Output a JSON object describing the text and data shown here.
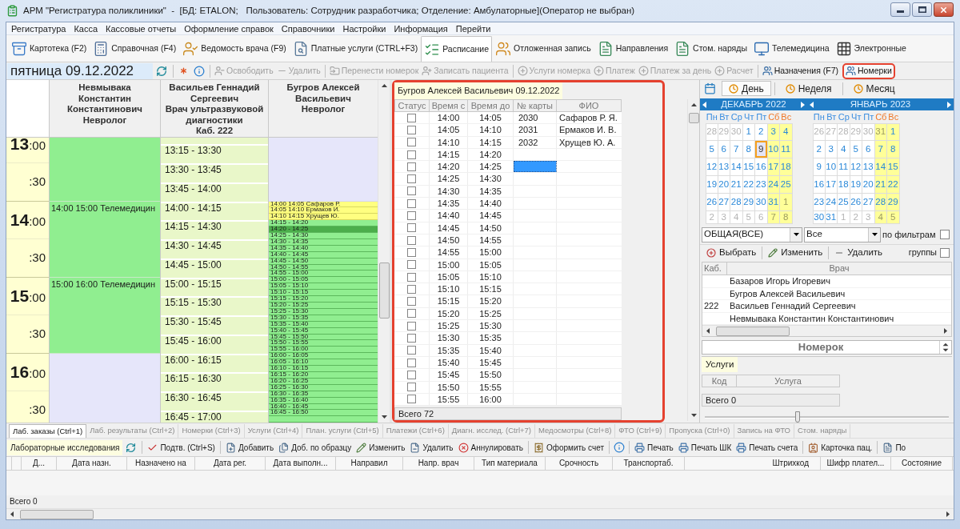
{
  "window": {
    "title": "АРМ \"Регистратура поликлиники\"  -  [БД: ETALON;   Пользователь: Сотрудник разработчика; Отделение: Амбулаторные](Оператор не выбран)"
  },
  "menu": [
    "Регистратура",
    "Касса",
    "Кассовые отчеты",
    "Оформление справок",
    "Справочники",
    "Настройки",
    "Информация",
    "Перейти"
  ],
  "main_toolbar": [
    {
      "label": "Картотека (F2)",
      "selected": false
    },
    {
      "label": "Справочная (F4)",
      "selected": false
    },
    {
      "label": "Ведомость врача (F9)",
      "selected": false
    },
    {
      "label": "Платные услуги (CTRL+F3)",
      "selected": false
    },
    {
      "label": "Расписание",
      "selected": true
    },
    {
      "label": "Отложенная запись",
      "selected": false
    },
    {
      "label": "Направления",
      "selected": false
    },
    {
      "label": "Стом. наряды",
      "selected": false
    },
    {
      "label": "Телемедицина",
      "selected": false
    },
    {
      "label": "Электронные",
      "selected": false
    }
  ],
  "schedule_toolbar": {
    "date": "пятница 09.12.2022",
    "buttons": [
      {
        "label": "Освободить",
        "disabled": true,
        "highlighted": false
      },
      {
        "label": "Удалить",
        "disabled": true,
        "highlighted": false
      },
      {
        "label": "Перенести номерок",
        "disabled": true,
        "highlighted": false
      },
      {
        "label": "Записать пациента",
        "disabled": true,
        "highlighted": false
      },
      {
        "label": "Услуги номерка",
        "disabled": true,
        "highlighted": false
      },
      {
        "label": "Платеж",
        "disabled": true,
        "highlighted": false
      },
      {
        "label": "Платеж за день",
        "disabled": true,
        "highlighted": false
      },
      {
        "label": "Расчет",
        "disabled": true,
        "highlighted": false
      },
      {
        "label": "Назначения (F7)",
        "disabled": false,
        "highlighted": false
      },
      {
        "label": "Номерки",
        "disabled": false,
        "highlighted": true
      }
    ]
  },
  "schedule": {
    "times": [
      {
        "hour": "13",
        "minutes": ":00"
      },
      {
        "minutes": ":30"
      },
      {
        "hour": "14",
        "minutes": ":00"
      },
      {
        "minutes": ":30"
      },
      {
        "hour": "15",
        "minutes": ":00"
      },
      {
        "minutes": ":30"
      },
      {
        "hour": "16",
        "minutes": ":00"
      },
      {
        "minutes": ":30"
      }
    ],
    "doctors": [
      {
        "name": "Невмывака Константин Константинович",
        "role": "Невролог",
        "slots": [
          {
            "kind": "reserved"
          },
          {
            "kind": "reserved",
            "label": "14:00 15:00 Телемедицин"
          },
          {
            "kind": "reserved",
            "label": "15:00 16:00 Телемедицин"
          },
          {
            "kind": "free"
          }
        ]
      },
      {
        "name": "Васильев Геннадий Сергеевич",
        "role": "Врач ультразвуковой диагностики",
        "room": "Каб. 222",
        "slots": [
          {
            "kind": "interval"
          },
          {
            "kind": "interval",
            "label": "13:15 - 13:30"
          },
          {
            "kind": "interval",
            "label": "13:30 - 13:45"
          },
          {
            "kind": "interval",
            "label": "13:45 - 14:00"
          },
          {
            "kind": "interval",
            "label": "14:00 - 14:15"
          },
          {
            "kind": "interval",
            "label": "14:15 - 14:30"
          },
          {
            "kind": "interval",
            "label": "14:30 - 14:45"
          },
          {
            "kind": "interval",
            "label": "14:45 - 15:00"
          },
          {
            "kind": "interval",
            "label": "15:00 - 15:15"
          },
          {
            "kind": "interval",
            "label": "15:15 - 15:30"
          },
          {
            "kind": "interval",
            "label": "15:30 - 15:45"
          },
          {
            "kind": "interval",
            "label": "15:45 - 16:00"
          },
          {
            "kind": "interval",
            "label": "16:00 - 16:15"
          },
          {
            "kind": "interval",
            "label": "16:15 - 16:30"
          },
          {
            "kind": "interval",
            "label": "16:30 - 16:45"
          },
          {
            "kind": "interval",
            "label": "16:45 - 17:00"
          }
        ]
      },
      {
        "name": "Бугров Алексей Васильевич",
        "role": "Невролог",
        "slots": [
          {
            "kind": "free",
            "selected": false
          },
          {
            "kind": "booked",
            "label": "14:00 14:05 Сафаров Р.",
            "selected": false
          },
          {
            "kind": "booked",
            "label": "14:05 14:10 Ермаков И.",
            "selected": false
          },
          {
            "kind": "booked",
            "label": "14:10 14:15 Хрущев Ю.",
            "selected": false
          },
          {
            "kind": "open",
            "label": "14:15 - 14:20",
            "selected": false
          },
          {
            "kind": "open",
            "label": "14:20 - 14:25",
            "selected": true
          },
          {
            "kind": "open",
            "label": "14:25 - 14:30",
            "selected": false
          },
          {
            "kind": "open",
            "label": "14:30 - 14:35",
            "selected": false
          },
          {
            "kind": "open",
            "label": "14:35 - 14:40",
            "selected": false
          },
          {
            "kind": "open",
            "label": "14:40 - 14:45",
            "selected": false
          },
          {
            "kind": "open",
            "label": "14:45 - 14:50",
            "selected": false
          },
          {
            "kind": "open",
            "label": "14:50 - 14:55",
            "selected": false
          },
          {
            "kind": "open",
            "label": "14:55 - 15:00",
            "selected": false
          },
          {
            "kind": "open",
            "label": "15:00 - 15:05",
            "selected": false
          },
          {
            "kind": "open",
            "label": "15:05 - 15:10",
            "selected": false
          },
          {
            "kind": "open",
            "label": "15:10 - 15:15",
            "selected": false
          },
          {
            "kind": "open",
            "label": "15:15 - 15:20",
            "selected": false
          },
          {
            "kind": "open",
            "label": "15:20 - 15:25",
            "selected": false
          },
          {
            "kind": "open",
            "label": "15:25 - 15:30",
            "selected": false
          },
          {
            "kind": "open",
            "label": "15:30 - 15:35",
            "selected": false
          },
          {
            "kind": "open",
            "label": "15:35 - 15:40",
            "selected": false
          },
          {
            "kind": "open",
            "label": "15:40 - 15:45",
            "selected": false
          },
          {
            "kind": "open",
            "label": "15:45 - 15:50",
            "selected": false
          },
          {
            "kind": "open",
            "label": "15:50 - 15:55",
            "selected": false
          },
          {
            "kind": "open",
            "label": "15:55 - 16:00",
            "selected": false
          },
          {
            "kind": "open",
            "label": "16:00 - 16:05",
            "selected": false
          },
          {
            "kind": "open",
            "label": "16:05 - 16:10",
            "selected": false
          },
          {
            "kind": "open",
            "label": "16:10 - 16:15",
            "selected": false
          },
          {
            "kind": "open",
            "label": "16:15 - 16:20",
            "selected": false
          },
          {
            "kind": "open",
            "label": "16:20 - 16:25",
            "selected": false
          },
          {
            "kind": "open",
            "label": "16:25 - 16:30",
            "selected": false
          },
          {
            "kind": "open",
            "label": "16:30 - 16:35",
            "selected": false
          },
          {
            "kind": "open",
            "label": "16:35 - 16:40",
            "selected": false
          },
          {
            "kind": "open",
            "label": "16:40 - 16:45",
            "selected": false
          },
          {
            "kind": "open",
            "label": "16:45 - 16:50",
            "selected": false
          },
          {
            "kind": "open",
            "selected": false
          }
        ]
      }
    ]
  },
  "appointments": {
    "title": "Бугров Алексей Васильевич 09.12.2022",
    "highlighted": true,
    "columns": [
      "Статус",
      "Время с",
      "Время до",
      "№ карты",
      "ФИО"
    ],
    "rows": [
      {
        "checked": false,
        "from": "14:00",
        "to": "14:05",
        "card": "2030",
        "patient": "Сафаров Р. Я.",
        "selected": false
      },
      {
        "checked": false,
        "from": "14:05",
        "to": "14:10",
        "card": "2031",
        "patient": "Ермаков И. В.",
        "selected": false
      },
      {
        "checked": false,
        "from": "14:10",
        "to": "14:15",
        "card": "2032",
        "patient": "Хрущев Ю. А.",
        "selected": false
      },
      {
        "checked": false,
        "from": "14:15",
        "to": "14:20",
        "selected": false
      },
      {
        "checked": false,
        "from": "14:20",
        "to": "14:25",
        "selected": true
      },
      {
        "checked": false,
        "from": "14:25",
        "to": "14:30",
        "selected": false
      },
      {
        "checked": false,
        "from": "14:30",
        "to": "14:35",
        "selected": false
      },
      {
        "checked": false,
        "from": "14:35",
        "to": "14:40",
        "selected": false
      },
      {
        "checked": false,
        "from": "14:40",
        "to": "14:45",
        "selected": false
      },
      {
        "checked": false,
        "from": "14:45",
        "to": "14:50",
        "selected": false
      },
      {
        "checked": false,
        "from": "14:50",
        "to": "14:55",
        "selected": false
      },
      {
        "checked": false,
        "from": "14:55",
        "to": "15:00",
        "selected": false
      },
      {
        "checked": false,
        "from": "15:00",
        "to": "15:05",
        "selected": false
      },
      {
        "checked": false,
        "from": "15:05",
        "to": "15:10",
        "selected": false
      },
      {
        "checked": false,
        "from": "15:10",
        "to": "15:15",
        "selected": false
      },
      {
        "checked": false,
        "from": "15:15",
        "to": "15:20",
        "selected": false
      },
      {
        "checked": false,
        "from": "15:20",
        "to": "15:25",
        "selected": false
      },
      {
        "checked": false,
        "from": "15:25",
        "to": "15:30",
        "selected": false
      },
      {
        "checked": false,
        "from": "15:30",
        "to": "15:35",
        "selected": false
      },
      {
        "checked": false,
        "from": "15:35",
        "to": "15:40",
        "selected": false
      },
      {
        "checked": false,
        "from": "15:40",
        "to": "15:45",
        "selected": false
      },
      {
        "checked": false,
        "from": "15:45",
        "to": "15:50",
        "selected": false
      },
      {
        "checked": false,
        "from": "15:50",
        "to": "15:55",
        "selected": false
      },
      {
        "checked": false,
        "from": "15:55",
        "to": "16:00",
        "selected": false
      }
    ],
    "total": "Всего 72"
  },
  "calendar_panel": {
    "views": [
      {
        "label": "День",
        "selected": true
      },
      {
        "label": "Неделя",
        "selected": false
      },
      {
        "label": "Месяц",
        "selected": false
      }
    ],
    "months": [
      {
        "title": "ДЕКАБРЬ 2022",
        "weekdays": [
          {
            "label": "Пн",
            "weekend": false
          },
          {
            "label": "Вт",
            "weekend": false
          },
          {
            "label": "Ср",
            "weekend": false
          },
          {
            "label": "Чт",
            "weekend": false
          },
          {
            "label": "Пт",
            "weekend": false
          },
          {
            "label": "Сб",
            "weekend": true
          },
          {
            "label": "Вс",
            "weekend": true
          }
        ],
        "weeks": [
          [
            {
              "day": "28",
              "muted": true,
              "selected": false
            },
            {
              "day": "29",
              "muted": true,
              "selected": false
            },
            {
              "day": "30",
              "muted": true,
              "selected": false
            },
            {
              "day": "1",
              "muted": false,
              "selected": false
            },
            {
              "day": "2",
              "muted": false,
              "selected": false
            },
            {
              "day": "3",
              "muted": false,
              "selected": false
            },
            {
              "day": "4",
              "muted": false,
              "selected": false
            }
          ],
          [
            {
              "day": "5",
              "muted": false,
              "selected": false
            },
            {
              "day": "6",
              "muted": false,
              "selected": false
            },
            {
              "day": "7",
              "muted": false,
              "selected": false
            },
            {
              "day": "8",
              "muted": false,
              "selected": false
            },
            {
              "day": "9",
              "muted": false,
              "selected": true
            },
            {
              "day": "10",
              "muted": false,
              "selected": false
            },
            {
              "day": "11",
              "muted": false,
              "selected": false
            }
          ],
          [
            {
              "day": "12",
              "muted": false,
              "selected": false
            },
            {
              "day": "13",
              "muted": false,
              "selected": false
            },
            {
              "day": "14",
              "muted": false,
              "selected": false
            },
            {
              "day": "15",
              "muted": false,
              "selected": false
            },
            {
              "day": "16",
              "muted": false,
              "selected": false
            },
            {
              "day": "17",
              "muted": false,
              "selected": false
            },
            {
              "day": "18",
              "muted": false,
              "selected": false
            }
          ],
          [
            {
              "day": "19",
              "muted": false,
              "selected": false
            },
            {
              "day": "20",
              "muted": false,
              "selected": false
            },
            {
              "day": "21",
              "muted": false,
              "selected": false
            },
            {
              "day": "22",
              "muted": false,
              "selected": false
            },
            {
              "day": "23",
              "muted": false,
              "selected": false
            },
            {
              "day": "24",
              "muted": false,
              "selected": false
            },
            {
              "day": "25",
              "muted": false,
              "selected": false
            }
          ],
          [
            {
              "day": "26",
              "muted": false,
              "selected": false
            },
            {
              "day": "27",
              "muted": false,
              "selected": false
            },
            {
              "day": "28",
              "muted": false,
              "selected": false
            },
            {
              "day": "29",
              "muted": false,
              "selected": false
            },
            {
              "day": "30",
              "muted": false,
              "selected": false
            },
            {
              "day": "31",
              "muted": false,
              "selected": false
            },
            {
              "day": "1",
              "muted": true,
              "selected": false
            }
          ],
          [
            {
              "day": "2",
              "muted": true,
              "selected": false
            },
            {
              "day": "3",
              "muted": true,
              "selected": false
            },
            {
              "day": "4",
              "muted": true,
              "selected": false
            },
            {
              "day": "5",
              "muted": true,
              "selected": false
            },
            {
              "day": "6",
              "muted": true,
              "selected": false
            },
            {
              "day": "7",
              "muted": true,
              "selected": false
            },
            {
              "day": "8",
              "muted": true,
              "selected": false
            }
          ]
        ]
      },
      {
        "title": "ЯНВАРЬ 2023",
        "weekdays": [
          {
            "label": "Пн",
            "weekend": false
          },
          {
            "label": "Вт",
            "weekend": false
          },
          {
            "label": "Ср",
            "weekend": false
          },
          {
            "label": "Чт",
            "weekend": false
          },
          {
            "label": "Пт",
            "weekend": false
          },
          {
            "label": "Сб",
            "weekend": true
          },
          {
            "label": "Вс",
            "weekend": true
          }
        ],
        "weeks": [
          [
            {
              "day": "26",
              "muted": true,
              "selected": false
            },
            {
              "day": "27",
              "muted": true,
              "selected": false
            },
            {
              "day": "28",
              "muted": true,
              "selected": false
            },
            {
              "day": "29",
              "muted": true,
              "selected": false
            },
            {
              "day": "30",
              "muted": true,
              "selected": false
            },
            {
              "day": "31",
              "muted": true,
              "selected": false
            },
            {
              "day": "1",
              "muted": false,
              "selected": false
            }
          ],
          [
            {
              "day": "2",
              "muted": false,
              "selected": false
            },
            {
              "day": "3",
              "muted": false,
              "selected": false
            },
            {
              "day": "4",
              "muted": false,
              "selected": false
            },
            {
              "day": "5",
              "muted": false,
              "selected": false
            },
            {
              "day": "6",
              "muted": false,
              "selected": false
            },
            {
              "day": "7",
              "muted": false,
              "selected": false
            },
            {
              "day": "8",
              "muted": false,
              "selected": false
            }
          ],
          [
            {
              "day": "9",
              "muted": false,
              "selected": false
            },
            {
              "day": "10",
              "muted": false,
              "selected": false
            },
            {
              "day": "11",
              "muted": false,
              "selected": false
            },
            {
              "day": "12",
              "muted": false,
              "selected": false
            },
            {
              "day": "13",
              "muted": false,
              "selected": false
            },
            {
              "day": "14",
              "muted": false,
              "selected": false
            },
            {
              "day": "15",
              "muted": false,
              "selected": false
            }
          ],
          [
            {
              "day": "16",
              "muted": false,
              "selected": false
            },
            {
              "day": "17",
              "muted": false,
              "selected": false
            },
            {
              "day": "18",
              "muted": false,
              "selected": false
            },
            {
              "day": "19",
              "muted": false,
              "selected": false
            },
            {
              "day": "20",
              "muted": false,
              "selected": false
            },
            {
              "day": "21",
              "muted": false,
              "selected": false
            },
            {
              "day": "22",
              "muted": false,
              "selected": false
            }
          ],
          [
            {
              "day": "23",
              "muted": false,
              "selected": false
            },
            {
              "day": "24",
              "muted": false,
              "selected": false
            },
            {
              "day": "25",
              "muted": false,
              "selected": false
            },
            {
              "day": "26",
              "muted": false,
              "selected": false
            },
            {
              "day": "27",
              "muted": false,
              "selected": false
            },
            {
              "day": "28",
              "muted": false,
              "selected": false
            },
            {
              "day": "29",
              "muted": false,
              "selected": false
            }
          ],
          [
            {
              "day": "30",
              "muted": false,
              "selected": false
            },
            {
              "day": "31",
              "muted": false,
              "selected": false
            },
            {
              "day": "1",
              "muted": true,
              "selected": false
            },
            {
              "day": "2",
              "muted": true,
              "selected": false
            },
            {
              "day": "3",
              "muted": true,
              "selected": false
            },
            {
              "day": "4",
              "muted": true,
              "selected": false
            },
            {
              "day": "5",
              "muted": true,
              "selected": false
            }
          ]
        ]
      }
    ]
  },
  "doctor_filter": {
    "department": "ОБЩАЯ(ВСЕ)",
    "specialty": "Все",
    "by_filters": {
      "label": "по фильтрам",
      "checked": false
    }
  },
  "doctor_actions": {
    "buttons": [
      "Выбрать",
      "Изменить",
      "Удалить"
    ],
    "groups_option": {
      "label": "группы",
      "checked": false
    }
  },
  "doctor_table": {
    "columns": [
      "Каб.",
      "Врач"
    ],
    "rows": [
      {
        "doctor": "Базаров Игорь Игоревич",
        "selected": false
      },
      {
        "doctor": "Бугров Алексей Васильевич",
        "selected": false
      },
      {
        "room": "222",
        "doctor": "Васильев Геннадий Сергеевич",
        "selected": false
      },
      {
        "doctor": "Невмывака Константин Константинович",
        "selected": false
      }
    ]
  },
  "ticket": {
    "title": "Номерок"
  },
  "services": {
    "tab": "Услуги",
    "columns": [
      "Код",
      "Услуга"
    ],
    "total": "Всего 0"
  },
  "zoom_slider": {
    "level": 0.38
  },
  "bottom_tabs": [
    {
      "label": "Лаб. заказы (Ctrl+1)",
      "selected": true
    },
    {
      "label": "Лаб. результаты (Ctrl+2)",
      "selected": false
    },
    {
      "label": "Номерки (Ctrl+3)",
      "selected": false
    },
    {
      "label": "Услуги (Ctrl+4)",
      "selected": false
    },
    {
      "label": "План. услуги (Ctrl+5)",
      "selected": false
    },
    {
      "label": "Платежи (Ctrl+6)",
      "selected": false
    },
    {
      "label": "Диагн. исслед. (Ctrl+7)",
      "selected": false
    },
    {
      "label": "Медосмотры (Ctrl+8)",
      "selected": false
    },
    {
      "label": "ФТО (Ctrl+9)",
      "selected": false
    },
    {
      "label": "Пропуска (Ctrl+0)",
      "selected": false
    },
    {
      "label": "Запись на ФТО",
      "selected": false
    },
    {
      "label": "Стом. наряды",
      "selected": false
    }
  ],
  "lab_toolbar": {
    "title": "Лабораторные исследования",
    "groups": [
      [
        "Подтв. (Ctrl+S)"
      ],
      [
        "Добавить",
        "Доб. по образцу",
        "Изменить",
        "Удалить",
        "Аннулировать"
      ],
      [
        "Оформить счет"
      ],
      [
        "Печать",
        "Печать ШК",
        "Печать счета"
      ],
      [
        "Карточка пац."
      ],
      [
        "По"
      ]
    ]
  },
  "lab_grid": {
    "columns": [
      "Д...",
      "Дата назн.",
      "Назначено на",
      "Дата рег.",
      "Дата выполн...",
      "Направил",
      "Напр. врач",
      "Тип материала",
      "Срочность",
      "Транспортаб.",
      "Штрихкод",
      "Шифр плател...",
      "Состояние"
    ],
    "total": "Всего 0"
  }
}
